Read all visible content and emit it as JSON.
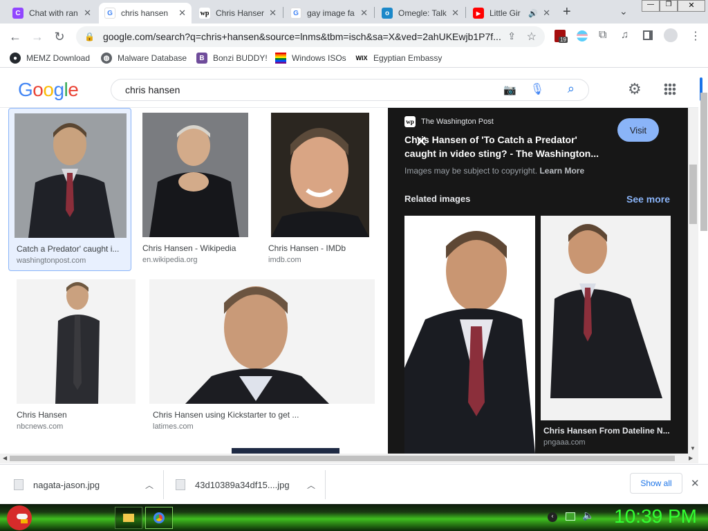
{
  "tabs": [
    {
      "title": "Chat with ran",
      "icon": "twitch-icon",
      "color": "#9146ff"
    },
    {
      "title": "chris hansen",
      "icon": "google-icon",
      "color": "#4285f4",
      "active": true
    },
    {
      "title": "Chris Hanser",
      "icon": "washington-post-icon",
      "color": "#000000"
    },
    {
      "title": "gay image fa",
      "icon": "google-icon",
      "color": "#4285f4"
    },
    {
      "title": "Omegle: Talk",
      "icon": "omegle-icon",
      "color": "#1b88c9"
    },
    {
      "title": "Little Gir",
      "icon": "youtube-icon",
      "color": "#ff0000"
    }
  ],
  "toolbar": {
    "url": "google.com/search?q=chris+hansen&source=lnms&tbm=isch&sa=X&ved=2ahUKEwjb1P7f...",
    "extension_badge": "19"
  },
  "bookmarks": [
    {
      "label": "MEMZ Download",
      "icon": "github-icon"
    },
    {
      "label": "Malware Database",
      "icon": "globe-icon"
    },
    {
      "label": "Bonzi BUDDY!",
      "icon": "bonzi-icon"
    },
    {
      "label": "Windows ISOs",
      "icon": "rainbow-flag-icon"
    },
    {
      "label": "Egyptian Embassy",
      "icon": "wix-icon"
    }
  ],
  "search": {
    "logo": "Google",
    "query": "chris hansen"
  },
  "results": [
    {
      "caption": "Catch a Predator' caught i...",
      "source": "washingtonpost.com"
    },
    {
      "caption": "Chris Hansen - Wikipedia",
      "source": "en.wikipedia.org"
    },
    {
      "caption": "Chris Hansen - IMDb",
      "source": "imdb.com"
    },
    {
      "caption": "Chris Hansen",
      "source": "nbcnews.com"
    },
    {
      "caption": "Chris Hansen using Kickstarter to get ...",
      "source": "latimes.com"
    }
  ],
  "panel": {
    "publisher": "The Washington Post",
    "title_line1": "Chris Hansen of 'To Catch a Predator'",
    "title_line2": "caught in video sting? - The Washington...",
    "visit_label": "Visit",
    "copyright_text": "Images may be subject to copyright.",
    "learn_more": "Learn More",
    "related_heading": "Related images",
    "see_more": "See more",
    "related": [
      {
        "caption": ""
      },
      {
        "caption": "Chris Hansen From Dateline N...",
        "source": "pngaaa.com"
      }
    ]
  },
  "downloads": [
    {
      "filename": "nagata-jason.jpg"
    },
    {
      "filename": "43d10389a34df15....jpg"
    }
  ],
  "shelf": {
    "show_all": "Show all"
  },
  "taskbar": {
    "clock": "10:39 PM"
  },
  "colors": {
    "accent_blue": "#1a73e8",
    "visit_button": "#8ab4f8",
    "panel_bg": "#171717",
    "clock_green": "#33ff33"
  }
}
